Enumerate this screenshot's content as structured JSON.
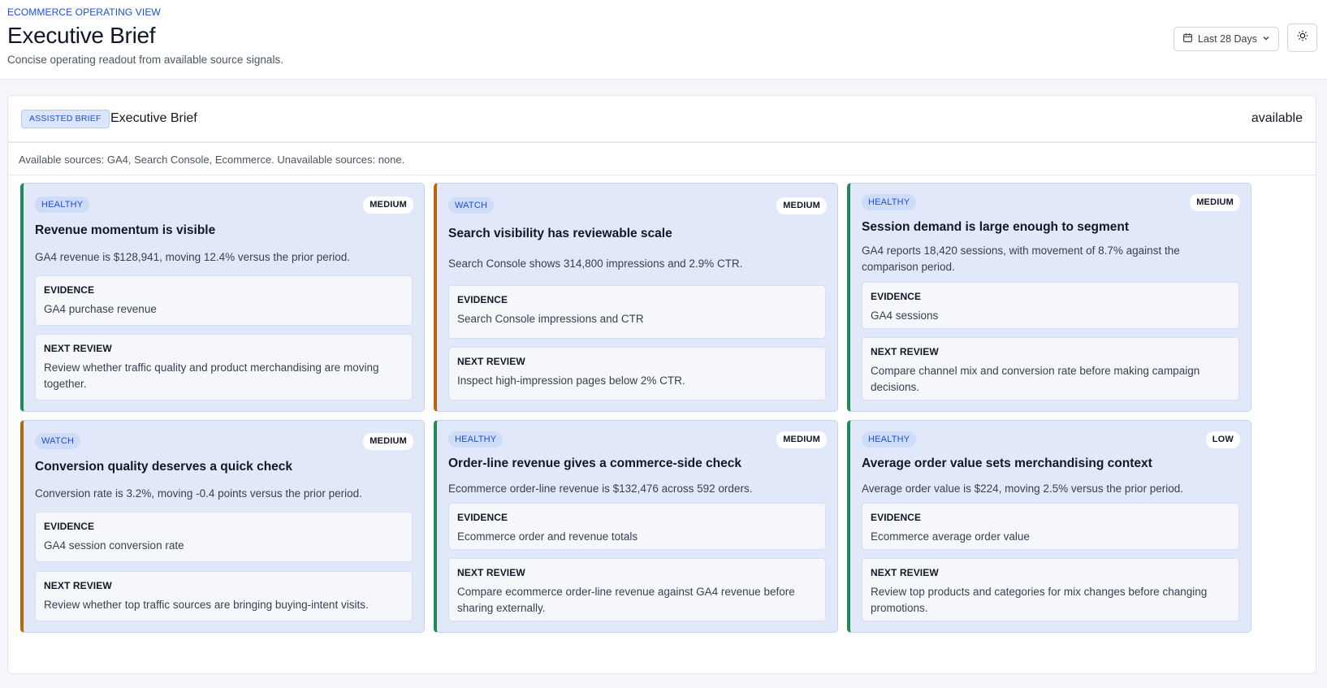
{
  "header": {
    "eyebrow": "ECOMMERCE OPERATING VIEW",
    "title": "Executive Brief",
    "subtitle": "Concise operating readout from available source signals.",
    "date_range": "Last 28 Days"
  },
  "brief": {
    "badge": "ASSISTED BRIEF",
    "title": "Executive Brief",
    "status": "available",
    "sources": "Available sources: GA4, Search Console, Ecommerce. Unavailable sources: none."
  },
  "evidence_label": "EVIDENCE",
  "next_review_label": "NEXT REVIEW",
  "cards": [
    {
      "status": "HEALTHY",
      "level": "MEDIUM",
      "title": "Revenue momentum is visible",
      "summary": "GA4 revenue is $128,941, moving 12.4% versus the prior period.",
      "evidence": "GA4 purchase revenue",
      "next_review": "Review whether traffic quality and product merchandising are moving together."
    },
    {
      "status": "WATCH",
      "level": "MEDIUM",
      "title": "Search visibility has reviewable scale",
      "summary": "Search Console shows 314,800 impressions and 2.9% CTR.",
      "evidence": "Search Console impressions and CTR",
      "next_review": "Inspect high-impression pages below 2% CTR."
    },
    {
      "status": "HEALTHY",
      "level": "MEDIUM",
      "title": "Session demand is large enough to segment",
      "summary": "GA4 reports 18,420 sessions, with movement of 8.7% against the comparison period.",
      "evidence": "GA4 sessions",
      "next_review": "Compare channel mix and conversion rate before making campaign decisions."
    },
    {
      "status": "WATCH",
      "level": "MEDIUM",
      "title": "Conversion quality deserves a quick check",
      "summary": "Conversion rate is 3.2%, moving -0.4 points versus the prior period.",
      "evidence": "GA4 session conversion rate",
      "next_review": "Review whether top traffic sources are bringing buying-intent visits."
    },
    {
      "status": "HEALTHY",
      "level": "MEDIUM",
      "title": "Order-line revenue gives a commerce-side check",
      "summary": "Ecommerce order-line revenue is $132,476 across 592 orders.",
      "evidence": "Ecommerce order and revenue totals",
      "next_review": "Compare ecommerce order-line revenue against GA4 revenue before sharing externally."
    },
    {
      "status": "HEALTHY",
      "level": "LOW",
      "title": "Average order value sets merchandising context",
      "summary": "Average order value is $224, moving 2.5% versus the prior period.",
      "evidence": "Ecommerce average order value",
      "next_review": "Review top products and categories for mix changes before changing promotions."
    }
  ],
  "colors": {
    "accent": "#1d4ed8",
    "healthy_border": "#1e8a55",
    "watch_border": "#b8660a",
    "card_background": "#e0e8f9"
  }
}
